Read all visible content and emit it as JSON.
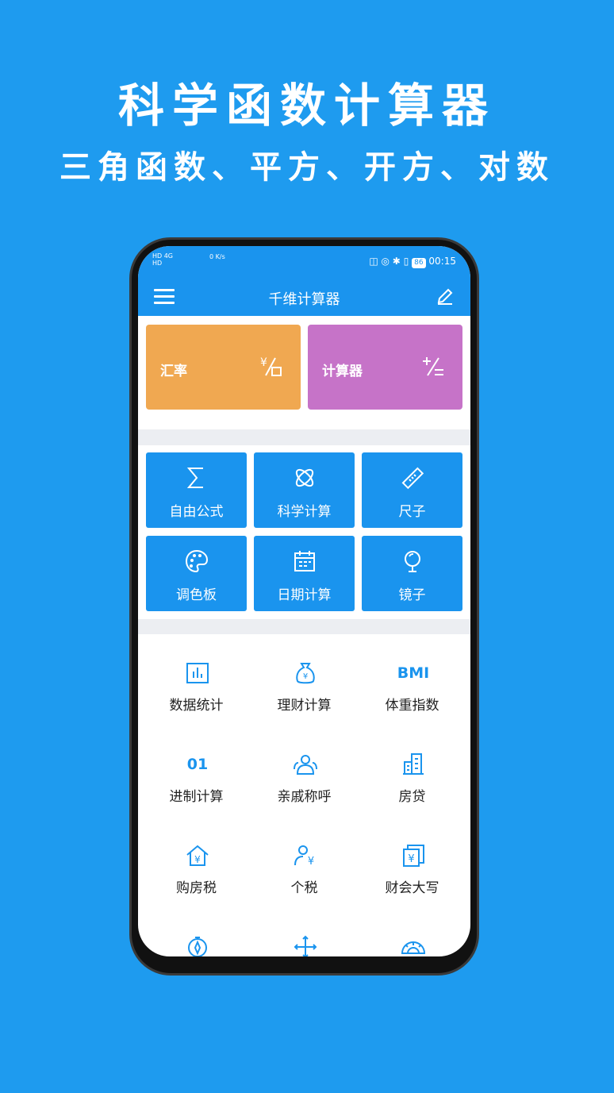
{
  "promo": {
    "headline": "科学函数计算器",
    "subline": "三角函数、平方、开方、对数"
  },
  "status_bar": {
    "left_text_1": "HD 4G",
    "left_text_2": "HD",
    "speed": "0 K/s",
    "battery": "86",
    "time": "00:15"
  },
  "app_bar": {
    "title": "千维计算器",
    "menu_icon": "hamburger-menu-icon",
    "edit_icon": "edit-pencil-icon"
  },
  "big_cards": [
    {
      "label": "汇率",
      "icon": "currency-exchange-icon",
      "color": "#f0a851"
    },
    {
      "label": "计算器",
      "icon": "calculator-ops-icon",
      "color": "#c673c8"
    }
  ],
  "tiles": [
    {
      "label": "自由公式",
      "icon": "sigma-icon"
    },
    {
      "label": "科学计算",
      "icon": "atom-icon"
    },
    {
      "label": "尺子",
      "icon": "ruler-icon"
    },
    {
      "label": "调色板",
      "icon": "palette-icon"
    },
    {
      "label": "日期计算",
      "icon": "calendar-icon"
    },
    {
      "label": "镜子",
      "icon": "mirror-icon"
    }
  ],
  "grid_items": [
    {
      "label": "数据统计",
      "icon": "bar-chart-icon"
    },
    {
      "label": "理财计算",
      "icon": "money-bag-icon"
    },
    {
      "label": "体重指数",
      "icon": "bmi-icon",
      "icon_text": "BMI"
    },
    {
      "label": "进制计算",
      "icon": "binary-icon",
      "icon_text": "01"
    },
    {
      "label": "亲戚称呼",
      "icon": "people-icon"
    },
    {
      "label": "房贷",
      "icon": "building-icon"
    },
    {
      "label": "购房税",
      "icon": "house-yuan-icon"
    },
    {
      "label": "个税",
      "icon": "person-yuan-icon"
    },
    {
      "label": "财会大写",
      "icon": "yuan-document-icon"
    },
    {
      "label": "",
      "icon": "compass-icon"
    },
    {
      "label": "",
      "icon": "move-arrows-icon"
    },
    {
      "label": "",
      "icon": "protractor-icon"
    }
  ],
  "colors": {
    "brand_blue": "#1a94ee",
    "background_blue": "#1e9bef",
    "rate_orange": "#f0a851",
    "calc_purple": "#c673c8"
  }
}
